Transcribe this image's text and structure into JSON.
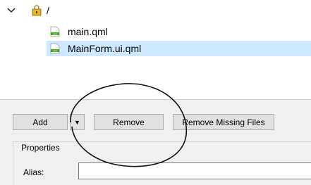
{
  "tree": {
    "root_label": "/",
    "files": [
      {
        "label": "main.qml",
        "icon": "qml-file-icon",
        "selected": false
      },
      {
        "label": "MainForm.ui.qml",
        "icon": "qml-file-icon",
        "selected": true
      }
    ]
  },
  "toolbar": {
    "add_label": "Add",
    "add_dropdown_icon": "triangle-down-icon",
    "remove_label": "Remove",
    "remove_missing_label": "Remove Missing Files"
  },
  "properties": {
    "title": "Properties",
    "alias_label": "Alias:",
    "alias_value": ""
  },
  "colors": {
    "selection": "#cde8ff",
    "panel_bg": "#f0f0f0",
    "button_bg": "#e1e1e1",
    "annotation": "#111111"
  }
}
